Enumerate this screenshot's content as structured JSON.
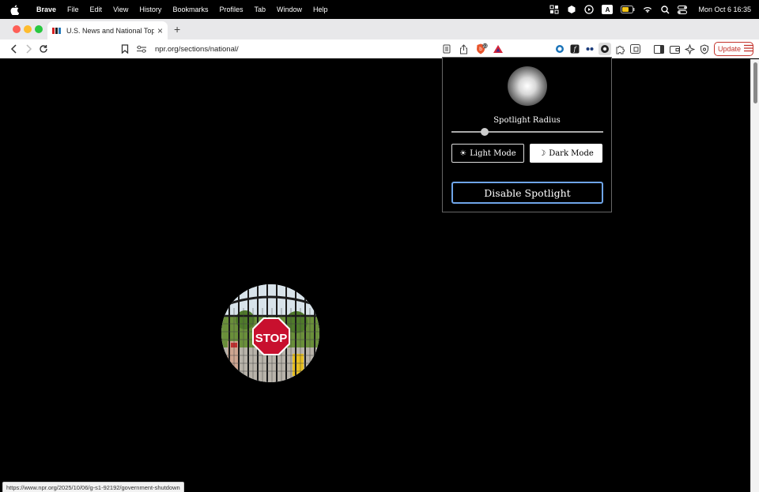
{
  "menubar": {
    "app_name": "Brave",
    "items": [
      "File",
      "Edit",
      "View",
      "History",
      "Bookmarks",
      "Profiles",
      "Tab",
      "Window",
      "Help"
    ],
    "clock": "Mon Oct 6  16:35",
    "input_source": "A"
  },
  "tab": {
    "title": "U.S. News and National Top Stori",
    "close": "×",
    "new_tab": "+"
  },
  "toolbar": {
    "url": "npr.org/sections/national/",
    "update_label": "Update",
    "brave_shields_count": "22"
  },
  "popup": {
    "radius_label": "Spotlight Radius",
    "radius_value": 0.22,
    "light_label": "Light Mode",
    "light_icon": "☀",
    "dark_label": "Dark Mode",
    "dark_icon": "☽",
    "disable_label": "Disable Spotlight"
  },
  "spotlight": {
    "sign_text": "STOP"
  },
  "status_bar": {
    "hover_url": "https://www.npr.org/2025/10/06/g-s1-92192/government-shutdown"
  },
  "colors": {
    "update": "#c3322b",
    "focus_ring": "#6fa5e8",
    "stop_sign": "#c8102e"
  }
}
